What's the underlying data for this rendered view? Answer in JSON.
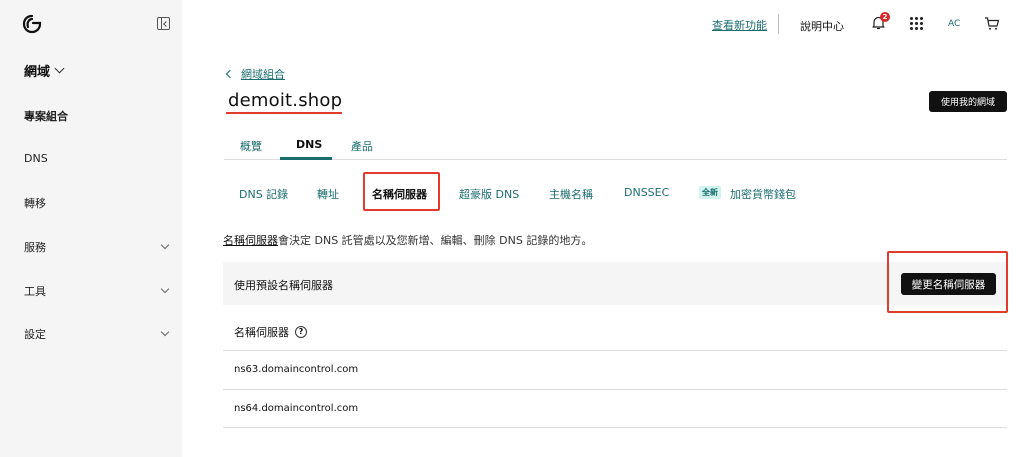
{
  "sidebar": {
    "section": "網域",
    "items": [
      {
        "label": "專案組合"
      },
      {
        "label": "DNS"
      },
      {
        "label": "轉移"
      },
      {
        "label": "服務"
      },
      {
        "label": "工具"
      },
      {
        "label": "設定"
      }
    ]
  },
  "topbar": {
    "whats_new": "查看新功能",
    "help": "說明中心",
    "notification_count": "2",
    "avatar_initials": "AC"
  },
  "breadcrumb": {
    "label": "網域組合"
  },
  "domain": {
    "name": "demoit.shop",
    "use_button": "使用我的網域"
  },
  "tabs": [
    {
      "label": "概覽"
    },
    {
      "label": "DNS"
    },
    {
      "label": "產品"
    }
  ],
  "subtabs": [
    {
      "label": "DNS 記錄"
    },
    {
      "label": "轉址"
    },
    {
      "label": "名稱伺服器"
    },
    {
      "label": "超豪版 DNS"
    },
    {
      "label": "主機名稱"
    },
    {
      "label": "DNSSEC"
    },
    {
      "label": "加密貨幣錢包",
      "badge": "全新"
    }
  ],
  "description": {
    "term": "名稱伺服器",
    "text": "會決定 DNS 託管處以及您新增、編輯、刪除 DNS 記錄的地方。"
  },
  "panel": {
    "label": "使用預設名稱伺服器",
    "change_button": "變更名稱伺服器"
  },
  "nameservers": {
    "header": "名稱伺服器",
    "help_glyph": "?",
    "rows": [
      "ns63.domaincontrol.com",
      "ns64.domaincontrol.com"
    ]
  },
  "colors": {
    "accent": "#1a6d6f",
    "highlight": "#e23b2e",
    "primary_button": "#111111"
  }
}
